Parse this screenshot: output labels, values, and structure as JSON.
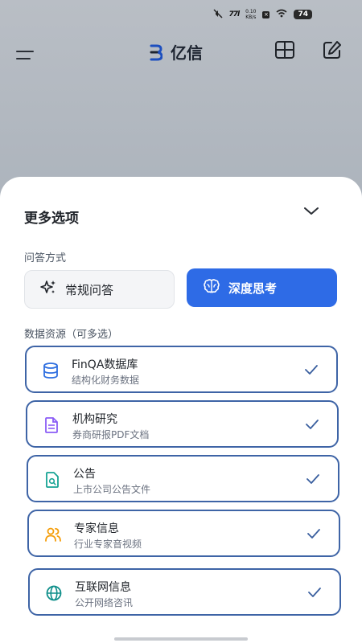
{
  "status_bar": {
    "net_speed": "0.10",
    "net_unit": "KB/s",
    "signal": "77l",
    "battery": "74"
  },
  "header": {
    "title": "亿信"
  },
  "sheet": {
    "title": "更多选项",
    "qa_section_label": "问答方式",
    "modes": [
      {
        "label": "常规问答",
        "icon": "sparkle-icon",
        "selected": false
      },
      {
        "label": "深度思考",
        "icon": "brain-icon",
        "selected": true
      }
    ],
    "sources_section_label": "数据资源（可多选）",
    "sources": [
      {
        "name": "FinQA数据库",
        "desc": "结构化财务数据",
        "icon": "database-icon",
        "color": "#2f6fe0",
        "checked": true
      },
      {
        "name": "机构研究",
        "desc": "券商研报PDF文档",
        "icon": "document-icon",
        "color": "#8b5cf6",
        "checked": true
      },
      {
        "name": "公告",
        "desc": "上市公司公告文件",
        "icon": "announcement-search-icon",
        "color": "#16a394",
        "checked": true
      },
      {
        "name": "专家信息",
        "desc": "行业专家音视频",
        "icon": "users-icon",
        "color": "#f59e0b",
        "checked": true
      },
      {
        "name": "互联网信息",
        "desc": "公开网络咨讯",
        "icon": "globe-icon",
        "color": "#0f8f8a",
        "checked": true
      }
    ]
  },
  "colors": {
    "accent": "#2e6be6",
    "card_border": "#3e64a6"
  }
}
